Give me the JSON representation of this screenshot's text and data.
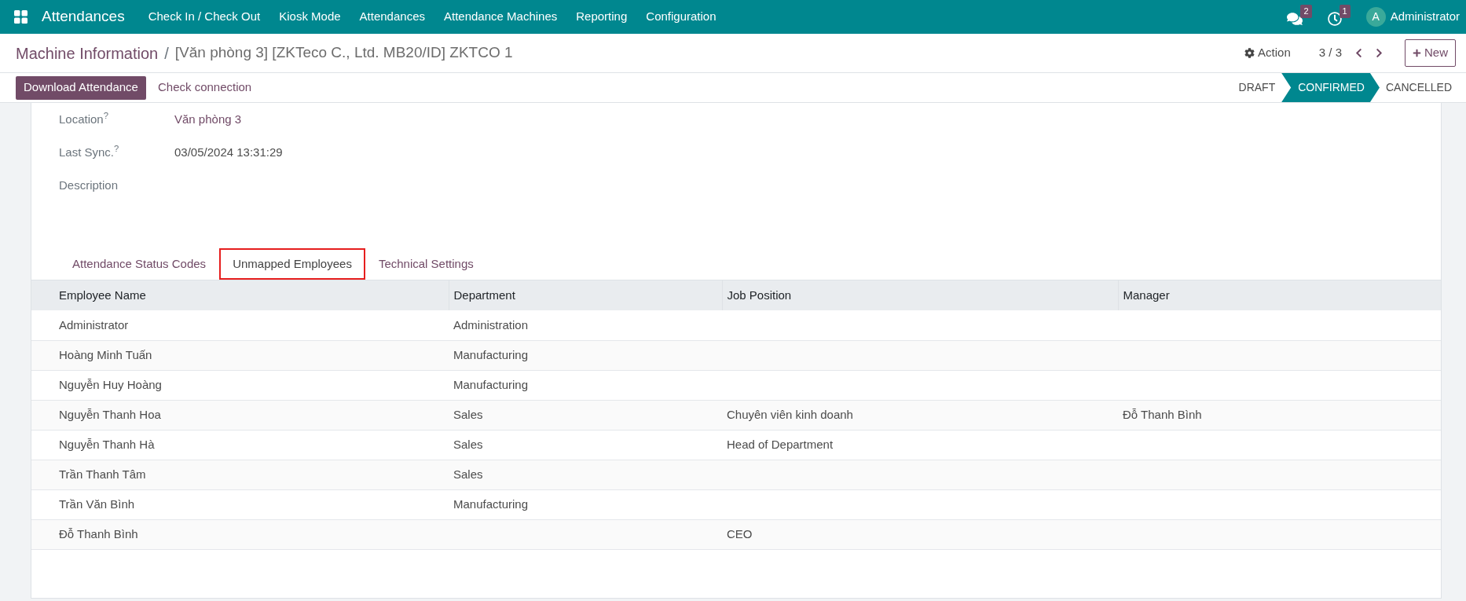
{
  "navbar": {
    "app_name": "Attendances",
    "menu": [
      "Check In / Check Out",
      "Kiosk Mode",
      "Attendances",
      "Attendance Machines",
      "Reporting",
      "Configuration"
    ],
    "systray": [
      {
        "kind": "messages",
        "badge": "2"
      },
      {
        "kind": "activities",
        "badge": "1"
      }
    ],
    "user": {
      "initial": "A",
      "name": "Administrator"
    }
  },
  "control_panel": {
    "breadcrumb": [
      "Machine Information",
      "[Văn phòng 3] [ZKTeco C., Ltd. MB20/ID] ZKTCO 1"
    ],
    "breadcrumb_separator": "/",
    "action": "Action",
    "pager": "3 / 3",
    "new_button": "New"
  },
  "buttons": [
    {
      "label": "Download Attendance",
      "kind": "primary"
    },
    {
      "label": "Check connection",
      "kind": "secondary"
    }
  ],
  "statusbar": [
    {
      "label": "DRAFT",
      "selected": false
    },
    {
      "label": "CONFIRMED",
      "selected": true
    },
    {
      "label": "CANCELLED",
      "selected": false
    }
  ],
  "fields": [
    {
      "label": "Location$^{?}$",
      "value": "Văn phòng 3",
      "kind": "link"
    },
    {
      "label": "Last Sync.$^{?}$",
      "value": "03/05/2024 13:31:29",
      "kind": "text"
    },
    {
      "label": "Description",
      "kind": "html"
    }
  ],
  "tabs": [
    {
      "label": "Attendance Status Codes",
      "selected": false
    },
    {
      "label": "Unmapped Employees",
      "selected": true
    },
    {
      "label": "Technical Settings",
      "selected": false
    }
  ],
  "table": {
    "columns": [
      "Employee Name",
      "Department",
      "Job Position",
      "Manager"
    ],
    "rows": [
      {
        "employee_name": "Administrator",
        "department": "Administration"
      },
      {
        "employee_name": "Hoàng Minh Tuấn",
        "department": "Manufacturing"
      },
      {
        "employee_name": "Nguyễn Huy Hoàng",
        "department": "Manufacturing"
      },
      {
        "employee_name": "Nguyễn Thanh Hoa",
        "department": "Sales",
        "job_position": "Chuyên viên kinh doanh",
        "manager": "Đỗ Thanh Bình"
      },
      {
        "employee_name": "Nguyễn Thanh Hà",
        "department": "Sales",
        "job_position": "Head of Department"
      },
      {
        "employee_name": "Trần Thanh Tâm",
        "department": "Sales"
      },
      {
        "employee_name": "Trần Văn Bình",
        "department": "Manufacturing"
      },
      {
        "employee_name": "Đỗ Thanh Bình",
        "job_position": "CEO"
      }
    ]
  }
}
